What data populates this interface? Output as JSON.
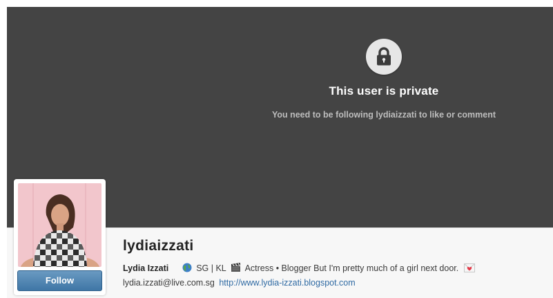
{
  "private_notice": {
    "icon": "lock-icon",
    "title": "This user is private",
    "subtitle": "You need to be following lydiaizzati to like or comment"
  },
  "profile": {
    "username": "lydiaizzati",
    "full_name": "Lydia Izzati",
    "bio": {
      "location": "SG | KL",
      "description": "Actress • Blogger But I'm pretty much of a girl next door.",
      "icons": [
        "globe-emoji-icon",
        "clapperboard-emoji-icon",
        "love-letter-emoji-icon"
      ]
    },
    "email": "lydia.izzati@live.com.sg",
    "website": "http://www.lydia-izzati.blogspot.com",
    "follow_label": "Follow"
  },
  "colors": {
    "hero_background": "#444444",
    "follow_button": "#4a7fae",
    "link": "#2f6aa3"
  }
}
